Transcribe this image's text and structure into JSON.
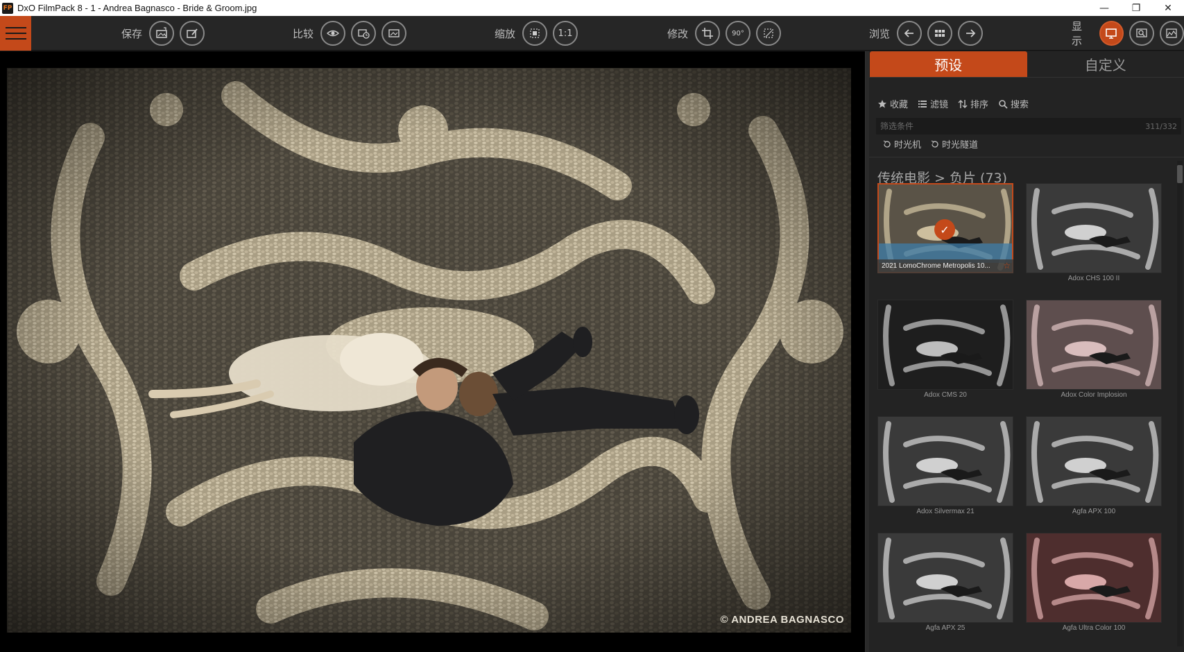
{
  "window": {
    "app_icon": "FP",
    "title": "DxO FilmPack 8 - 1 - Andrea Bagnasco - Bride & Groom.jpg",
    "controls": {
      "minimize": "—",
      "restore": "❐",
      "close": "✕"
    }
  },
  "toolbar": {
    "save": {
      "label": "保存"
    },
    "compare": {
      "label": "比较"
    },
    "zoom": {
      "label": "缩放",
      "one_to_one": "1:1"
    },
    "edit": {
      "label": "修改",
      "rotate": "90°"
    },
    "browse": {
      "label": "浏览"
    },
    "display": {
      "label": "显示"
    },
    "accent_color": "#c4491a"
  },
  "viewer": {
    "copyright": "© ANDREA BAGNASCO"
  },
  "panel": {
    "tabs": [
      {
        "label": "预设",
        "active": true
      },
      {
        "label": "自定义",
        "active": false
      }
    ],
    "filters": {
      "favorites": "收藏",
      "filter": "滤镜",
      "sort": "排序",
      "search": "搜索"
    },
    "filter_box": {
      "placeholder": "筛选条件",
      "count": "311/332"
    },
    "time_machine": "时光机",
    "time_tunnel": "时光隧道",
    "breadcrumb": "传统电影 > 负片 (73)",
    "presets": [
      {
        "name": "2021 LomoChrome Metropolis 10...",
        "selected": true,
        "tone": "warm"
      },
      {
        "name": "Adox CHS 100 II",
        "selected": false,
        "tone": "bw"
      },
      {
        "name": "Adox CMS 20",
        "selected": false,
        "tone": "bwdark"
      },
      {
        "name": "Adox Color Implosion",
        "selected": false,
        "tone": "pink"
      },
      {
        "name": "Adox Silvermax 21",
        "selected": false,
        "tone": "bw"
      },
      {
        "name": "Agfa APX 100",
        "selected": false,
        "tone": "bw"
      },
      {
        "name": "Agfa APX 25",
        "selected": false,
        "tone": "bw"
      },
      {
        "name": "Agfa Ultra Color 100",
        "selected": false,
        "tone": "red"
      }
    ]
  }
}
